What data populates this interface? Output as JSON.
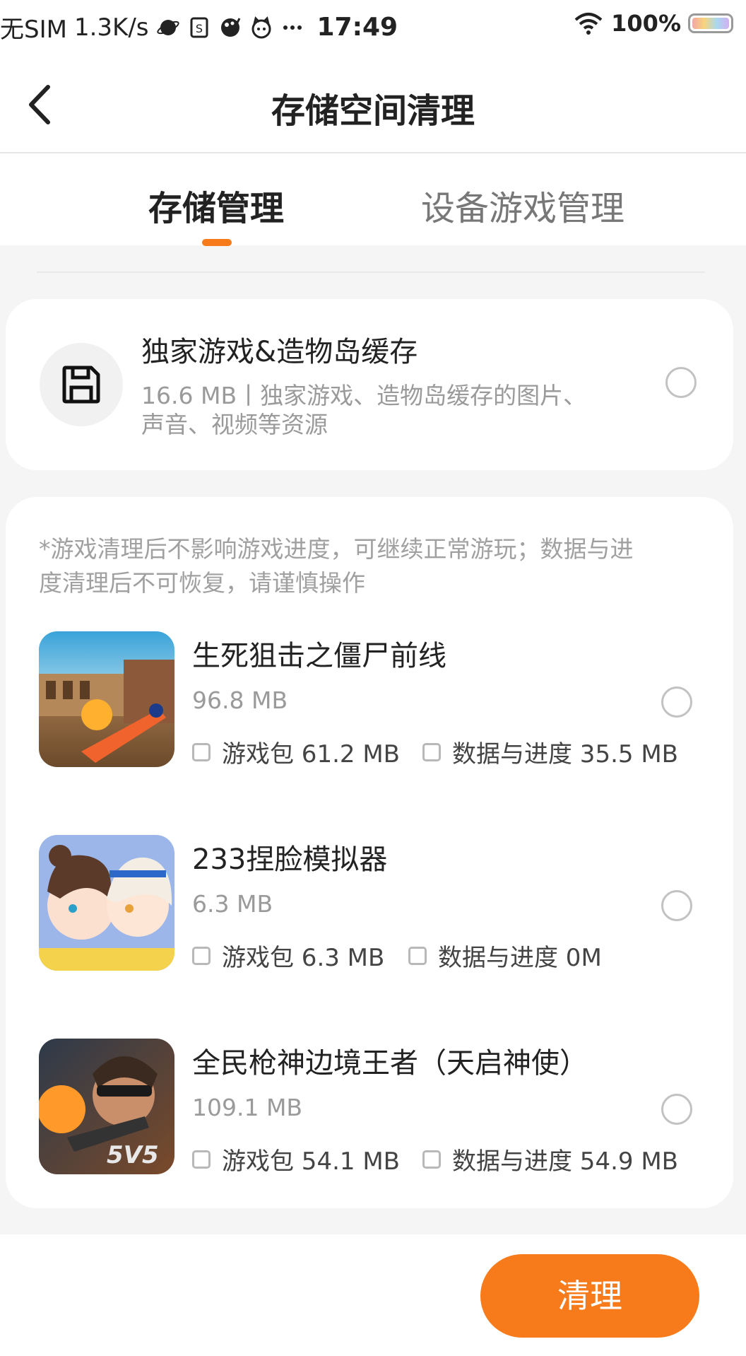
{
  "status_bar": {
    "sim": "无SIM",
    "speed": "1.3K/s",
    "time": "17:49",
    "battery": "100%",
    "icons": [
      "planet-icon",
      "sim-card-icon",
      "paint-icon",
      "cat-face-icon",
      "more-dots-icon",
      "wifi-icon",
      "battery-icon"
    ]
  },
  "header": {
    "title": "存储空间清理",
    "back_icon": "chevron-left-icon"
  },
  "tabs": [
    {
      "label": "存储管理",
      "active": true
    },
    {
      "label": "设备游戏管理",
      "active": false
    }
  ],
  "accent_color": "#f77b1b",
  "cache_card": {
    "icon": "floppy-disk-icon",
    "title": "独家游戏&造物岛缓存",
    "desc_line1": "16.6 MB丨独家游戏、造物岛缓存的图片、",
    "desc_line2": "声音、视频等资源"
  },
  "games_card": {
    "notice_line1": "*游戏清理后不影响游戏进度，可继续正常游玩；数据与进",
    "notice_line2": "度清理后不可恢复，请谨慎操作",
    "games": [
      {
        "name": "生死狙击之僵尸前线",
        "size": "96.8 MB",
        "package": "游戏包 61.2 MB",
        "data": "数据与进度 35.5 MB"
      },
      {
        "name": "233捏脸模拟器",
        "size": "6.3 MB",
        "package": "游戏包 6.3 MB",
        "data": "数据与进度 0M"
      },
      {
        "name": "全民枪神边境王者（天启神使）",
        "size": "109.1 MB",
        "package": "游戏包 54.1 MB",
        "data": "数据与进度 54.9 MB"
      }
    ]
  },
  "footer": {
    "clean_button": "清理"
  }
}
